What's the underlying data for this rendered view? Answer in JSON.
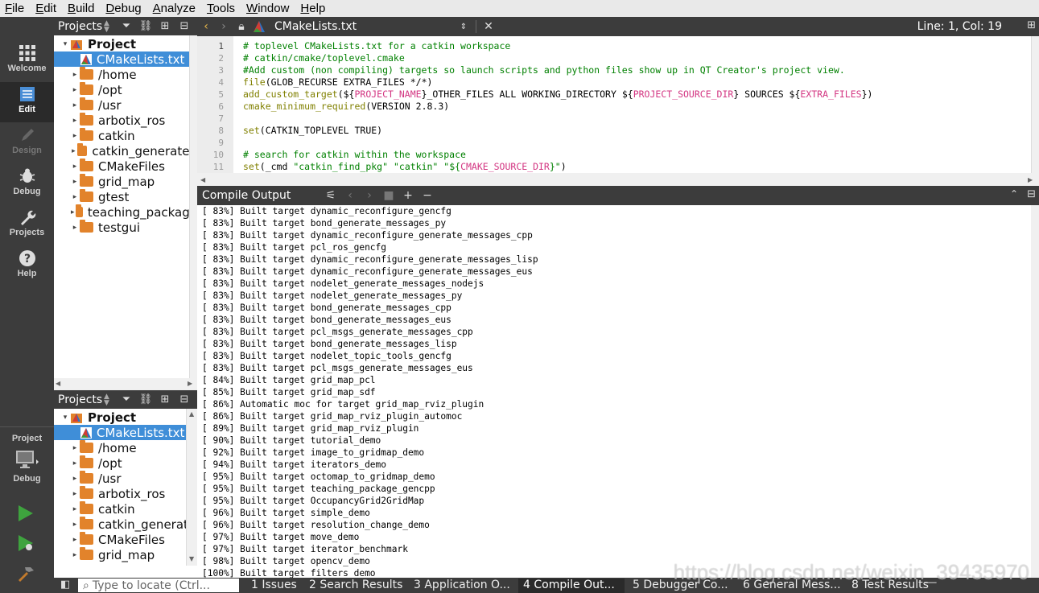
{
  "menubar": [
    {
      "underline": "F",
      "rest": "ile"
    },
    {
      "underline": "E",
      "rest": "dit"
    },
    {
      "underline": "B",
      "rest": "uild"
    },
    {
      "underline": "D",
      "rest": "ebug"
    },
    {
      "underline": "A",
      "rest": "nalyze"
    },
    {
      "underline": "T",
      "rest": "ools"
    },
    {
      "underline": "W",
      "rest": "indow"
    },
    {
      "underline": "H",
      "rest": "elp"
    }
  ],
  "modes": {
    "welcome": "Welcome",
    "edit": "Edit",
    "design": "Design",
    "debug": "Debug",
    "projects": "Projects",
    "help": "Help"
  },
  "target_selector": {
    "project_label": "Project",
    "config_label": "Debug"
  },
  "sidebar_top": {
    "title": "Projects",
    "items": [
      {
        "label": "Project",
        "kind": "project"
      },
      {
        "label": "CMakeLists.txt",
        "kind": "cmake"
      },
      {
        "label": "/home",
        "kind": "folder"
      },
      {
        "label": "/opt",
        "kind": "folder"
      },
      {
        "label": "/usr",
        "kind": "folder"
      },
      {
        "label": "arbotix_ros",
        "kind": "folder"
      },
      {
        "label": "catkin",
        "kind": "folder"
      },
      {
        "label": "catkin_generated",
        "kind": "folder"
      },
      {
        "label": "CMakeFiles",
        "kind": "folder"
      },
      {
        "label": "grid_map",
        "kind": "folder"
      },
      {
        "label": "gtest",
        "kind": "folder"
      },
      {
        "label": "teaching_package",
        "kind": "folder"
      },
      {
        "label": "testgui",
        "kind": "folder"
      }
    ]
  },
  "sidebar_bottom": {
    "title": "Projects",
    "items": [
      {
        "label": "Project",
        "kind": "project"
      },
      {
        "label": "CMakeLists.txt",
        "kind": "cmake"
      },
      {
        "label": "/home",
        "kind": "folder"
      },
      {
        "label": "/opt",
        "kind": "folder"
      },
      {
        "label": "/usr",
        "kind": "folder"
      },
      {
        "label": "arbotix_ros",
        "kind": "folder"
      },
      {
        "label": "catkin",
        "kind": "folder"
      },
      {
        "label": "catkin_generat",
        "kind": "folder"
      },
      {
        "label": "CMakeFiles",
        "kind": "folder"
      },
      {
        "label": "grid_map",
        "kind": "folder"
      }
    ]
  },
  "editor": {
    "filename": "CMakeLists.txt",
    "cursor": "Line: 1, Col: 19",
    "current_line": 1,
    "lines": [
      [
        {
          "t": "# toplevel CMakeLists.txt for a catkin workspace",
          "c": "cmt"
        }
      ],
      [
        {
          "t": "# catkin/cmake/toplevel.cmake",
          "c": "cmt"
        }
      ],
      [
        {
          "t": "#Add custom (non compiling) targets so launch scripts and python files show up in QT Creator's project view.",
          "c": "cmt"
        }
      ],
      [
        {
          "t": "file",
          "c": "cmd"
        },
        {
          "t": "(GLOB_RECURSE EXTRA_FILES */*)",
          "c": ""
        }
      ],
      [
        {
          "t": "add_custom_target",
          "c": "cmd"
        },
        {
          "t": "(${",
          "c": ""
        },
        {
          "t": "PROJECT_NAME",
          "c": "var"
        },
        {
          "t": "}_OTHER_FILES ALL WORKING_DIRECTORY ${",
          "c": ""
        },
        {
          "t": "PROJECT_SOURCE_DIR",
          "c": "var"
        },
        {
          "t": "} SOURCES ${",
          "c": ""
        },
        {
          "t": "EXTRA_FILES",
          "c": "var"
        },
        {
          "t": "})",
          "c": ""
        }
      ],
      [
        {
          "t": "cmake_minimum_required",
          "c": "cmd"
        },
        {
          "t": "(VERSION 2.8.3)",
          "c": ""
        }
      ],
      [],
      [
        {
          "t": "set",
          "c": "cmd"
        },
        {
          "t": "(CATKIN_TOPLEVEL TRUE)",
          "c": ""
        }
      ],
      [],
      [
        {
          "t": "# search for catkin within the workspace",
          "c": "cmt"
        }
      ],
      [
        {
          "t": "set",
          "c": "cmd"
        },
        {
          "t": "(_cmd ",
          "c": ""
        },
        {
          "t": "\"catkin_find_pkg\"",
          "c": "str"
        },
        {
          "t": " ",
          "c": ""
        },
        {
          "t": "\"catkin\"",
          "c": "str"
        },
        {
          "t": " ",
          "c": ""
        },
        {
          "t": "\"${",
          "c": "str"
        },
        {
          "t": "CMAKE_SOURCE_DIR",
          "c": "var"
        },
        {
          "t": "}\"",
          "c": "str"
        },
        {
          "t": ")",
          "c": ""
        }
      ]
    ]
  },
  "output_pane": {
    "title": "Compile Output",
    "lines": [
      "[ 83%] Built target dynamic_reconfigure_gencfg",
      "[ 83%] Built target bond_generate_messages_py",
      "[ 83%] Built target dynamic_reconfigure_generate_messages_cpp",
      "[ 83%] Built target pcl_ros_gencfg",
      "[ 83%] Built target dynamic_reconfigure_generate_messages_lisp",
      "[ 83%] Built target dynamic_reconfigure_generate_messages_eus",
      "[ 83%] Built target nodelet_generate_messages_nodejs",
      "[ 83%] Built target nodelet_generate_messages_py",
      "[ 83%] Built target bond_generate_messages_cpp",
      "[ 83%] Built target bond_generate_messages_eus",
      "[ 83%] Built target pcl_msgs_generate_messages_cpp",
      "[ 83%] Built target bond_generate_messages_lisp",
      "[ 83%] Built target nodelet_topic_tools_gencfg",
      "[ 83%] Built target pcl_msgs_generate_messages_eus",
      "[ 84%] Built target grid_map_pcl",
      "[ 85%] Built target grid_map_sdf",
      "[ 86%] Automatic moc for target grid_map_rviz_plugin",
      "[ 86%] Built target grid_map_rviz_plugin_automoc",
      "[ 89%] Built target grid_map_rviz_plugin",
      "[ 90%] Built target tutorial_demo",
      "[ 92%] Built target image_to_gridmap_demo",
      "[ 94%] Built target iterators_demo",
      "[ 95%] Built target octomap_to_gridmap_demo",
      "[ 95%] Built target teaching_package_gencpp",
      "[ 95%] Built target OccupancyGrid2GridMap",
      "[ 96%] Built target simple_demo",
      "[ 96%] Built target resolution_change_demo",
      "[ 97%] Built target move_demo",
      "[ 97%] Built target iterator_benchmark",
      "[ 98%] Built target opencv_demo",
      "[100%] Built target filters_demo"
    ]
  },
  "statusbar": {
    "locator_placeholder": "Type to locate (Ctrl...",
    "tabs": [
      {
        "label": "1  Issues"
      },
      {
        "label": "2  Search Results"
      },
      {
        "label": "3  Application O..."
      },
      {
        "label": "4  Compile Out..."
      },
      {
        "label": "5  Debugger Co..."
      },
      {
        "label": "6  General Mess..."
      },
      {
        "label": "8  Test Results"
      }
    ],
    "active_tab": 3
  },
  "watermark": "https://blog.csdn.net/weixin_39435970",
  "colors": {
    "accent": "#3f8ed8",
    "folder": "#e2832b",
    "dark": "#3c3c3c"
  }
}
